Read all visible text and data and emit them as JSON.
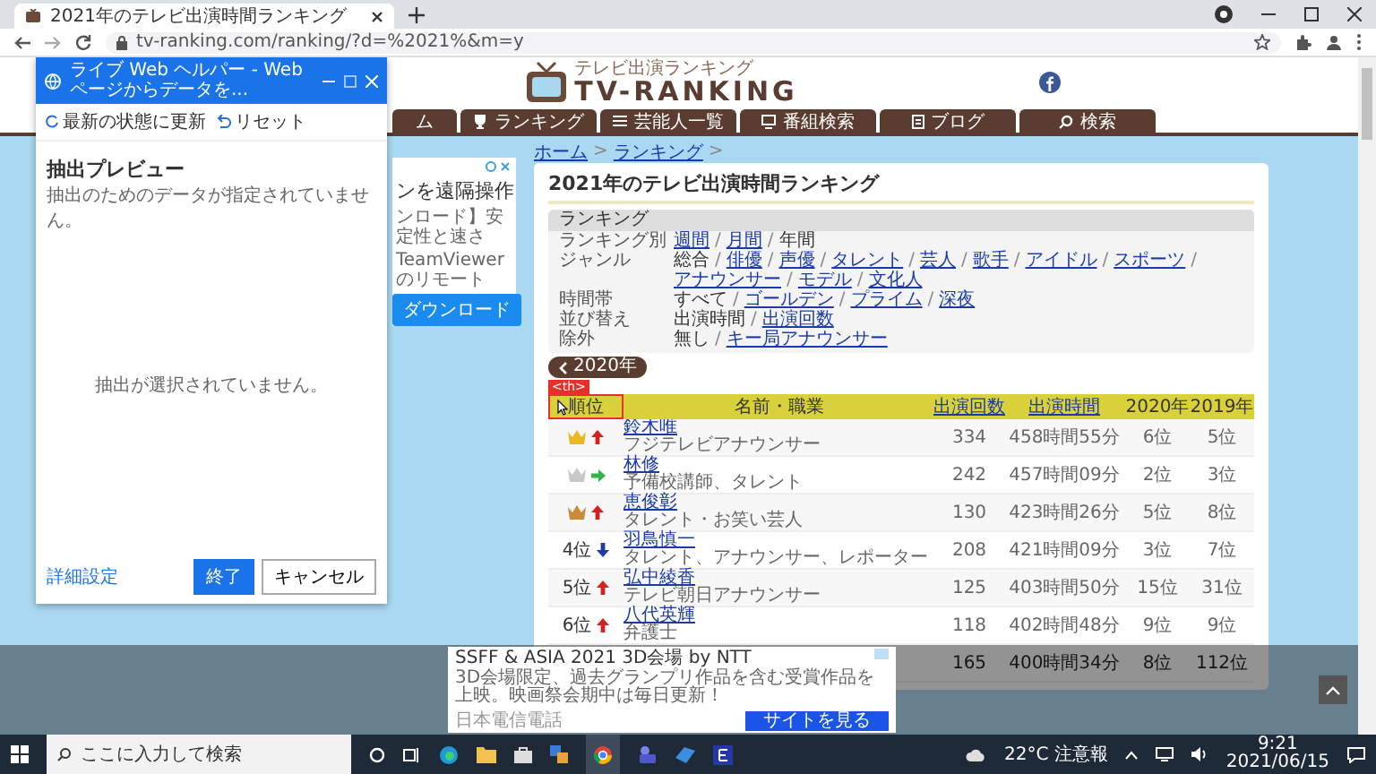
{
  "browser": {
    "tab_title": "2021年のテレビ出演時間ランキング",
    "url": "tv-ranking.com/ranking/?d=%2021%&m=y"
  },
  "helper": {
    "title": "ライブ Web ヘルパー - Web ページからデータを...",
    "toolbar": [
      {
        "kind": "refresh",
        "label": "最新の状態に更新"
      },
      {
        "kind": "undo",
        "label": "リセット"
      }
    ],
    "preview_title": "抽出プレビュー",
    "preview_note": "抽出のためのデータが指定されていません。",
    "empty_message": "抽出が選択されていません。",
    "settings_link": "詳細設定",
    "buttons": [
      {
        "label": "終了",
        "primary": true
      },
      {
        "label": "キャンセル",
        "primary": false
      }
    ]
  },
  "site": {
    "tagline": "テレビ出演ランキング",
    "logo": "TV-RANKING",
    "nav": [
      {
        "label": "ム"
      },
      {
        "label": "ランキング"
      },
      {
        "label": "芸能人一覧"
      },
      {
        "label": "番組検索"
      },
      {
        "label": "ブログ"
      },
      {
        "label": "検索"
      }
    ]
  },
  "side_ad": {
    "headline": "ンを遠隔操作",
    "lines": [
      "ンロード】安定性と速さ",
      "TeamViewerのリモート"
    ],
    "button": "ダウンロード"
  },
  "breadcrumb": {
    "items": [
      "ホーム",
      "ランキング"
    ],
    "separator": ">"
  },
  "ranking": {
    "title": "2021年のテレビ出演時間ランキング",
    "filter": {
      "heading": "ランキング",
      "separator": "/",
      "rows": [
        {
          "label": "ランキング別",
          "options": [
            {
              "label": "週間",
              "selected": false
            },
            {
              "label": "月間",
              "selected": false
            },
            {
              "label": "年間",
              "selected": true
            }
          ]
        },
        {
          "label": "ジャンル",
          "options": [
            {
              "label": "総合",
              "selected": true
            },
            {
              "label": "俳優",
              "selected": false
            },
            {
              "label": "声優",
              "selected": false
            },
            {
              "label": "タレント",
              "selected": false
            },
            {
              "label": "芸人",
              "selected": false
            },
            {
              "label": "歌手",
              "selected": false
            },
            {
              "label": "アイドル",
              "selected": false
            },
            {
              "label": "スポーツ",
              "selected": false
            },
            {
              "label": "アナウンサー",
              "selected": false
            },
            {
              "label": "モデル",
              "selected": false
            },
            {
              "label": "文化人",
              "selected": false
            }
          ]
        },
        {
          "label": "時間帯",
          "options": [
            {
              "label": "すべて",
              "selected": true
            },
            {
              "label": "ゴールデン",
              "selected": false
            },
            {
              "label": "プライム",
              "selected": false
            },
            {
              "label": "深夜",
              "selected": false
            }
          ]
        },
        {
          "label": "並び替え",
          "options": [
            {
              "label": "出演時間",
              "selected": true
            },
            {
              "label": "出演回数",
              "selected": false
            }
          ]
        },
        {
          "label": "除外",
          "options": [
            {
              "label": "無し",
              "selected": true
            },
            {
              "label": "キー局アナウンサー",
              "selected": false
            }
          ]
        }
      ]
    },
    "prev_year": "2020年"
  },
  "table": {
    "selection_tag": "<th>",
    "columns": [
      {
        "label": "順位",
        "link": false,
        "highlighted": true
      },
      {
        "label": "名前・職業",
        "link": false,
        "highlighted": false
      },
      {
        "label": "出演回数",
        "link": true,
        "highlighted": false
      },
      {
        "label": "出演時間",
        "link": true,
        "highlighted": false
      },
      {
        "label": "2020年",
        "link": false,
        "highlighted": false
      },
      {
        "label": "2019年",
        "link": false,
        "highlighted": false
      }
    ],
    "rows": [
      {
        "kind": "medal",
        "crown": {
          "color": "#e8b923"
        },
        "trend": {
          "kind": "up"
        },
        "name": "鈴木唯",
        "job": "フジテレビアナウンサー",
        "count": "334",
        "time": "458時間55分",
        "y2020": "6位",
        "y2019": "5位"
      },
      {
        "kind": "medal",
        "crown": {
          "color": "#c8c8c8"
        },
        "trend": {
          "kind": "same"
        },
        "name": "林修",
        "job": "予備校講師、タレント",
        "count": "242",
        "time": "457時間09分",
        "y2020": "2位",
        "y2019": "3位"
      },
      {
        "kind": "medal",
        "crown": {
          "color": "#c98a3a"
        },
        "trend": {
          "kind": "up"
        },
        "name": "恵俊彰",
        "job": "タレント・お笑い芸人",
        "count": "130",
        "time": "423時間26分",
        "y2020": "5位",
        "y2019": "8位"
      },
      {
        "kind": "rank",
        "rank": "4位",
        "trend": {
          "kind": "down"
        },
        "name": "羽鳥慎一",
        "job": "タレント、アナウンサー、レポーター",
        "count": "208",
        "time": "421時間09分",
        "y2020": "3位",
        "y2019": "7位"
      },
      {
        "kind": "rank",
        "rank": "5位",
        "trend": {
          "kind": "up"
        },
        "name": "弘中綾香",
        "job": "テレビ朝日アナウンサー",
        "count": "125",
        "time": "403時間50分",
        "y2020": "15位",
        "y2019": "31位"
      },
      {
        "kind": "rank",
        "rank": "6位",
        "trend": {
          "kind": "up"
        },
        "name": "八代英輝",
        "job": "弁護士",
        "count": "118",
        "time": "402時間48分",
        "y2020": "9位",
        "y2019": "9位"
      }
    ],
    "partial_row": {
      "count": "165",
      "time": "400時間34分",
      "y2020": "8位",
      "y2019": "112位"
    }
  },
  "bottom_ad": {
    "title": "SSFF & ASIA 2021 3D会場 by NTT",
    "body": "3D会場限定、過去グランプリ作品を含む受賞作品を上映。映画祭会期中は毎日更新！",
    "advertiser": "日本電信電話",
    "button": "サイトを見る"
  },
  "taskbar": {
    "search_placeholder": "ここに入力して検索",
    "weather": "22°C 注意報",
    "time": "9:21",
    "date": "2021/06/15"
  }
}
